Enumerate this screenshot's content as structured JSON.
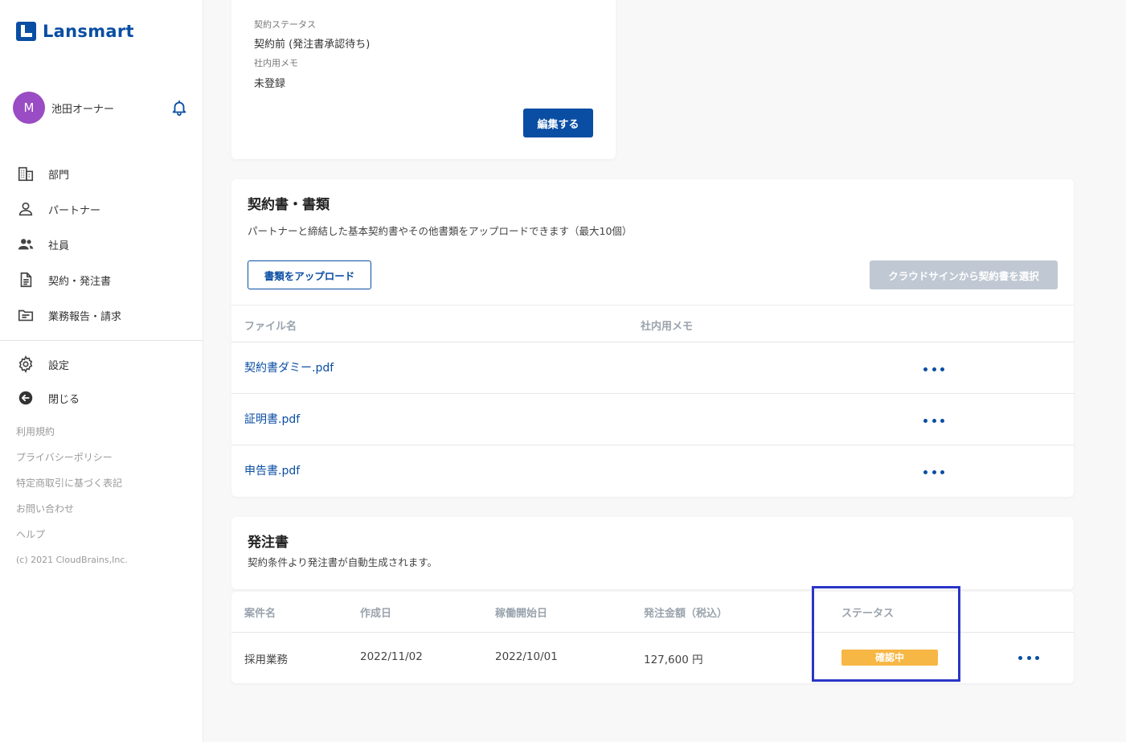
{
  "brand": {
    "name": "Lansmart"
  },
  "user": {
    "initial": "M",
    "name": "池田オーナー"
  },
  "nav": [
    {
      "label": "部門",
      "icon": "building-icon"
    },
    {
      "label": "パートナー",
      "icon": "person-icon"
    },
    {
      "label": "社員",
      "icon": "people-icon"
    },
    {
      "label": "契約・発注書",
      "icon": "document-icon"
    },
    {
      "label": "業務報告・請求",
      "icon": "folder-icon"
    }
  ],
  "nav2": [
    {
      "label": "設定",
      "icon": "gear-icon"
    },
    {
      "label": "閉じる",
      "icon": "arrow-left-circle-icon"
    }
  ],
  "footer": {
    "links": [
      "利用規約",
      "プライバシーポリシー",
      "特定商取引に基づく表記",
      "お問い合わせ",
      "ヘルプ"
    ],
    "copyright": "(c) 2021 CloudBrains,Inc."
  },
  "contract_info": {
    "status_label": "契約ステータス",
    "status_value": "契約前 (発注書承認待ち)",
    "memo_label": "社内用メモ",
    "memo_value": "未登録",
    "edit_button": "編集する"
  },
  "documents": {
    "title": "契約書・書類",
    "description": "パートナーと締結した基本契約書やその他書類をアップロードできます（最大10個）",
    "upload_button": "書類をアップロード",
    "cloudsign_button": "クラウドサインから契約書を選択",
    "columns": [
      "ファイル名",
      "社内用メモ"
    ],
    "files": [
      "契約書ダミー.pdf",
      "証明書.pdf",
      "申告書.pdf"
    ]
  },
  "purchase_orders": {
    "title": "発注書",
    "description": "契約条件より発注書が自動生成されます。",
    "columns": [
      "案件名",
      "作成日",
      "稼働開始日",
      "発注金額（税込）",
      "ステータス"
    ],
    "rows": [
      {
        "name": "採用業務",
        "created": "2022/11/02",
        "start": "2022/10/01",
        "amount": "127,600 円",
        "status": "確認中"
      }
    ]
  },
  "colors": {
    "primary": "#0a4ea3",
    "badge": "#f7b744",
    "highlight": "#2b35c7",
    "avatar": "#9a4cc4"
  }
}
